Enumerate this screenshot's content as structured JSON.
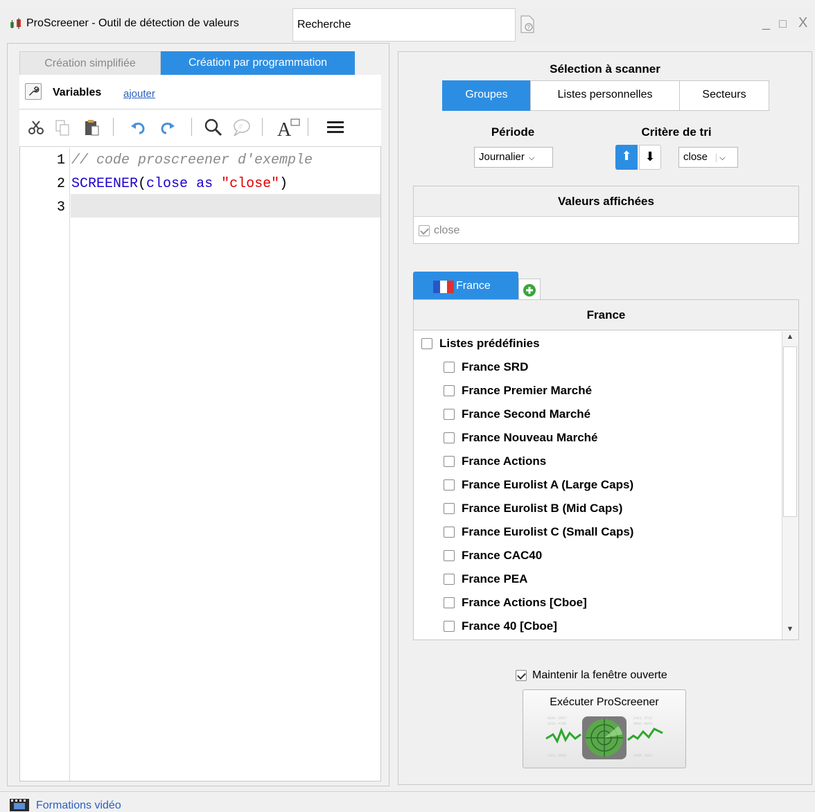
{
  "window": {
    "title": "ProScreener - Outil de détection de valeurs",
    "search_value": "Recherche",
    "controls": [
      "_",
      "□",
      "X"
    ]
  },
  "left": {
    "tabs": [
      "Création simplifiée",
      "Création par programmation"
    ],
    "active_tab": "Création par programmation",
    "variables_label": "Variables",
    "add_link": "ajouter",
    "toolbar_icons": [
      "cut-icon",
      "copy-icon",
      "paste-icon",
      "undo-icon",
      "redo-icon",
      "search-icon",
      "comment-icon",
      "font-size-icon",
      "menu-icon"
    ],
    "code": {
      "line_numbers": [
        "1",
        "2",
        "3"
      ],
      "line1_comment": "// code proscreener d'exemple",
      "line2_kw": "SCREENER",
      "line2_open": "(",
      "line2_var": "close",
      "line2_as": "as",
      "line2_str": "\"close\"",
      "line2_close": ")"
    }
  },
  "right": {
    "selection_title": "Sélection à scanner",
    "segments": [
      "Groupes",
      "Listes personnelles",
      "Secteurs"
    ],
    "active_segment": "Groupes",
    "periode_label": "Période",
    "periode_value": "Journalier",
    "tri_label": "Critère de tri",
    "tri_value": "close",
    "sort_up": "⬆",
    "sort_down": "⬇",
    "values_title": "Valeurs affichées",
    "values_item": "close",
    "market_tab": "France",
    "list_title": "France",
    "root_item": "Listes prédéfinies",
    "items": [
      "France SRD",
      "France Premier Marché",
      "France Second Marché",
      "France Nouveau Marché",
      "France Actions",
      "France Eurolist A (Large Caps)",
      "France Eurolist B (Mid Caps)",
      "France Eurolist C (Small Caps)",
      "France CAC40",
      "France PEA",
      "France Actions [Cboe]",
      "France 40 [Cboe]"
    ],
    "keep_open_label": "Maintenir la fenêtre ouverte",
    "keep_open_checked": true,
    "run_label": "Exécuter ProScreener"
  },
  "status": {
    "video_label": "Formations vidéo"
  },
  "colors": {
    "accent": "#2c8ee3",
    "link": "#2a5fbf",
    "code_keyword": "#1c00cf",
    "code_string": "#e00000",
    "code_comment": "#8a8a8a"
  }
}
